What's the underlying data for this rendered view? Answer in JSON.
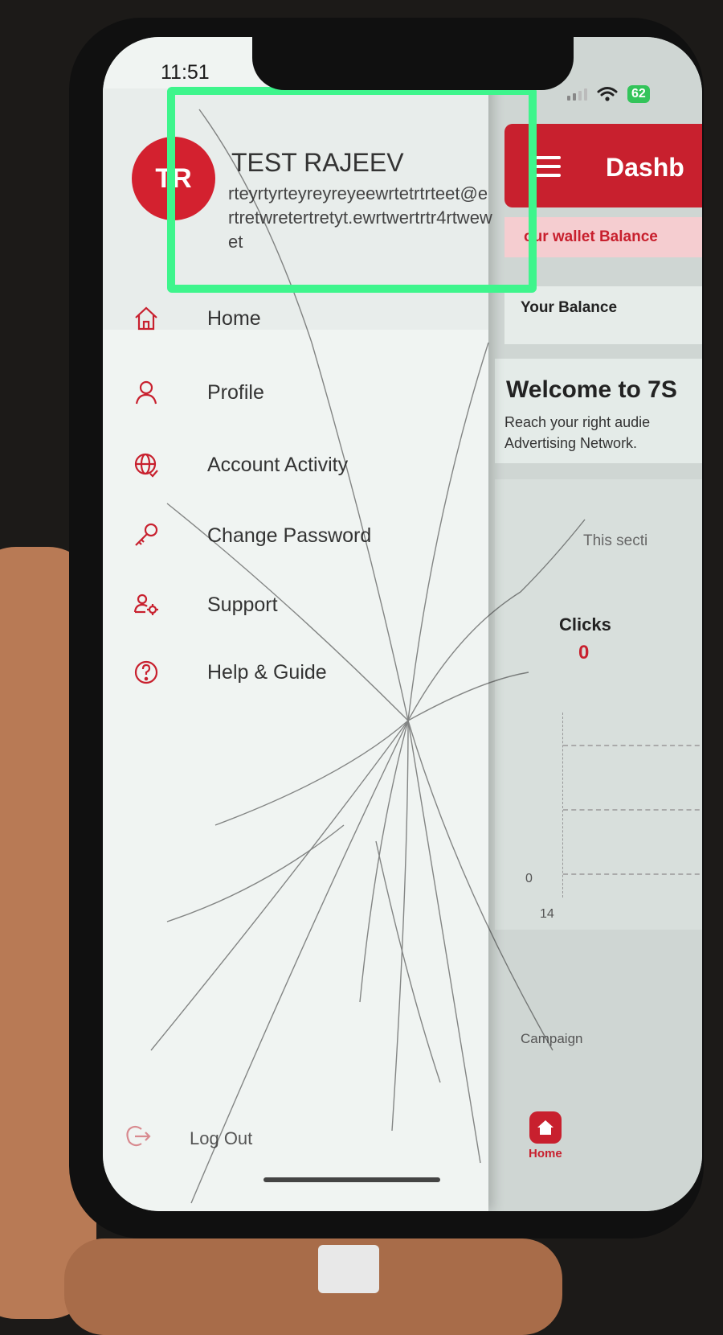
{
  "status_bar": {
    "time": "11:51",
    "battery": "62"
  },
  "drawer": {
    "avatar_initials": "TR",
    "user_name": "TEST RAJEEV",
    "user_email": "rteyrtyrteyreyreyeewrtetrtrteet@ertretwretertretyt.ewrtwertrtr4rtwewet",
    "menu": [
      {
        "label": "Home",
        "icon": "home-icon"
      },
      {
        "label": "Profile",
        "icon": "user-icon"
      },
      {
        "label": "Account Activity",
        "icon": "globe-icon"
      },
      {
        "label": "Change Password",
        "icon": "key-icon"
      },
      {
        "label": "Support",
        "icon": "support-icon"
      },
      {
        "label": "Help & Guide",
        "icon": "help-icon"
      }
    ],
    "logout_label": "Log Out"
  },
  "dashboard": {
    "title": "Dashb",
    "wallet_banner": "our wallet Balance",
    "balance_label": "Your Balance",
    "welcome_title": "Welcome to 7S",
    "welcome_sub_1": "Reach your right audie",
    "welcome_sub_2": "Advertising Network.",
    "section_note": "This secti",
    "clicks_label": "Clicks",
    "clicks_value": "0",
    "chart_y_zero": "0",
    "chart_x_tick": "14",
    "campaign_label": "Campaign",
    "bottom_nav_home": "Home"
  },
  "colors": {
    "brand": "#c8202e",
    "highlight": "#3ef58c",
    "battery": "#33c45a"
  }
}
